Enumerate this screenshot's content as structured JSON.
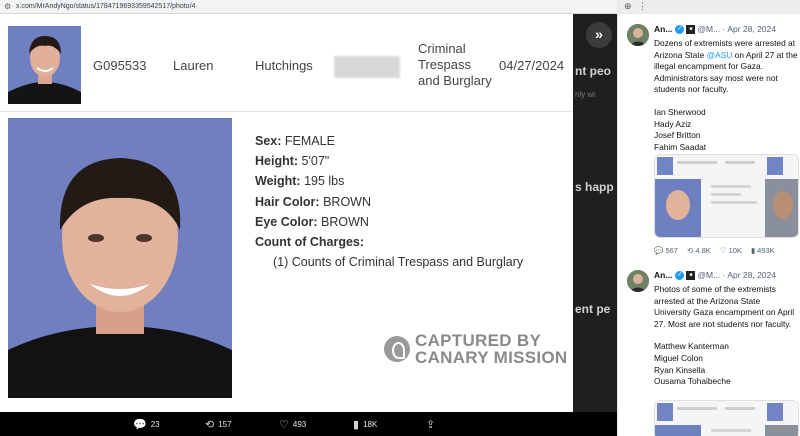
{
  "browser": {
    "url": "x.com/MrAndyNgo/status/1784719693359542517/photo/4"
  },
  "background": {
    "heading_1": "nt peo",
    "heading_2": "s happ",
    "heading_3": "ent pe",
    "snippet": "nly wi"
  },
  "record": {
    "booking_number": "G095533",
    "first_name": "Lauren",
    "last_name": "Hutchings",
    "charge_summary": "Criminal Trespass and Burglary",
    "date": "04/27/2024",
    "details": [
      {
        "label": "Sex:",
        "value": "FEMALE"
      },
      {
        "label": "Height:",
        "value": "5'07\""
      },
      {
        "label": "Weight:",
        "value": "195 lbs"
      },
      {
        "label": "Hair Color:",
        "value": "BROWN"
      },
      {
        "label": "Eye Color:",
        "value": "BROWN"
      }
    ],
    "charges_label": "Count of Charges:",
    "charge_line": "(1) Counts of Criminal Trespass and Burglary"
  },
  "watermark": {
    "line1": "CAPTURED BY",
    "line2": "CANARY MISSION"
  },
  "actions": {
    "replies": "23",
    "reposts": "157",
    "likes": "493",
    "views": "18K"
  },
  "sidebar": {
    "tweets": [
      {
        "name": "An...",
        "handle": "@M...",
        "date": "· Apr 28, 2024",
        "text_pre": "Dozens of extremists were arrested at Arizona State ",
        "mention": "@ASU",
        "text_post": " on April 27 at the illegal encampment for Gaza. Administrators say most were not students nor faculty.",
        "names": [
          "Ian Sherwood",
          "Hady Aziz",
          "Josef Britton",
          "Fahim Saadat"
        ],
        "stats": {
          "replies": "567",
          "reposts": "4.8K",
          "likes": "10K",
          "views": "493K"
        }
      },
      {
        "name": "An...",
        "handle": "@M...",
        "date": "· Apr 28, 2024",
        "text": "Photos of some of the extremists arrested at the Arizona State University Gaza encampment on April 27. Most are not students nor faculty.",
        "names": [
          "Matthew Kanterman",
          "Miguel Colon",
          "Ryan Kinsella",
          "Ousama Tohaibeche"
        ]
      }
    ]
  },
  "colors": {
    "accent": "#1d9bf0",
    "mugshot_bg": "#6f7fc0"
  }
}
